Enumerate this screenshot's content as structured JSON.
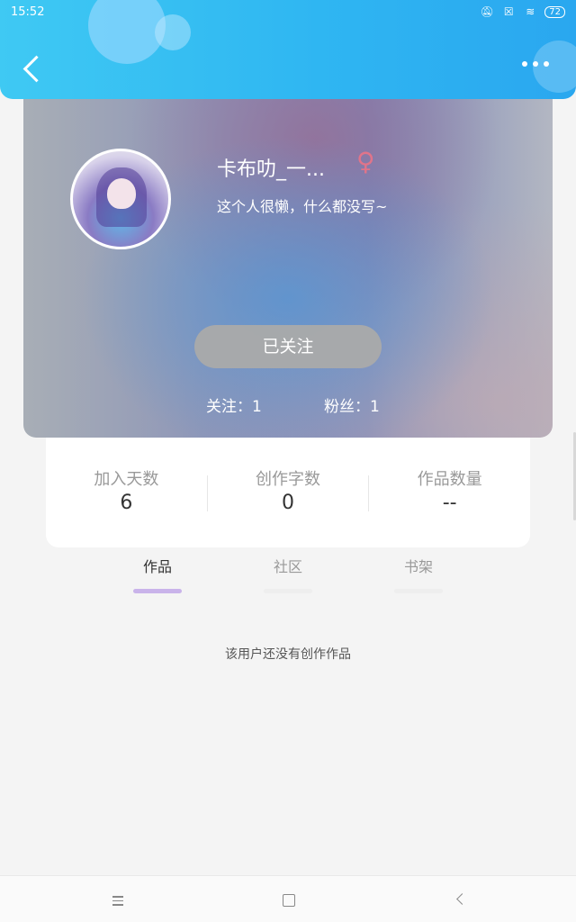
{
  "status_bar": {
    "time": "15:52",
    "battery": "72",
    "icons": [
      "mute-icon",
      "sim-off-icon",
      "wifi-icon",
      "battery-icon"
    ]
  },
  "header": {
    "back_icon": "chevron-left-icon",
    "more_icon": "more-dots-icon"
  },
  "profile": {
    "username": "卡布叻_一...",
    "gender_symbol": "♀",
    "gender_color": "#e0748a",
    "bio": "这个人很懒，什么都没写~",
    "follow_button": "已关注",
    "following": "关注：1",
    "fans": "粉丝：1"
  },
  "stats": [
    {
      "label": "加入天数",
      "value": "6"
    },
    {
      "label": "创作字数",
      "value": "0"
    },
    {
      "label": "作品数量",
      "value": "--"
    }
  ],
  "tabs": [
    {
      "label": "作品",
      "active": true
    },
    {
      "label": "社区",
      "active": false
    },
    {
      "label": "书架",
      "active": false
    }
  ],
  "empty_message": "该用户还没有创作作品",
  "colors": {
    "header_start": "#3fc9f3",
    "header_end": "#2aa7ef",
    "tab_indicator": "#c9b3ea"
  }
}
